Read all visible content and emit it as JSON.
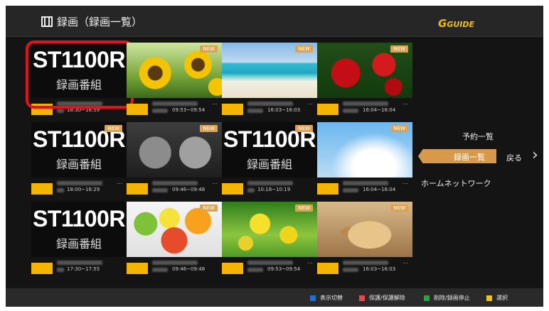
{
  "header": {
    "title": "録画（録画一覧）",
    "logo_text": "GUIDE"
  },
  "new_label": "NEW",
  "st_main": "ST1100R",
  "st_sub": "録画番組",
  "tiles": [
    {
      "kind": "st",
      "time": "18:30~18:59",
      "selected": true
    },
    {
      "kind": "sun",
      "time": "09:53~09:54",
      "new": true,
      "dots": "…"
    },
    {
      "kind": "beach",
      "time": "16:03~16:03",
      "new": true,
      "dots": "…"
    },
    {
      "kind": "roses",
      "time": "16:04~16:04",
      "new": true,
      "dots": "…"
    },
    {
      "kind": "st",
      "time": "18:00~18:29",
      "new": true,
      "dots": "…"
    },
    {
      "kind": "kittens",
      "time": "09:46~09:48",
      "new": true,
      "dots": "…"
    },
    {
      "kind": "st",
      "time": "10:18~10:19",
      "new": true
    },
    {
      "kind": "sky",
      "time": "16:04~16:04",
      "new": true,
      "dots": "…"
    },
    {
      "kind": "st",
      "time": "17:30~17:55"
    },
    {
      "kind": "fruits",
      "time": "09:46~09:48",
      "new": true
    },
    {
      "kind": "rapeseed",
      "time": "09:53~09:54",
      "new": true,
      "dots": "…"
    },
    {
      "kind": "puppy",
      "time": "16:03~16:03",
      "new": true,
      "dots": "…"
    }
  ],
  "side_menu": {
    "reservation": "予約一覧",
    "recorded": "録画一覧",
    "back": "戻る",
    "home_network": "ホームネットワーク"
  },
  "legend": [
    {
      "color": "#1f6fd6",
      "label": "表示切替"
    },
    {
      "color": "#e5484d",
      "label": "保護/保護解除"
    },
    {
      "color": "#2ea043",
      "label": "削除/録画停止"
    },
    {
      "color": "#f1c40f",
      "label": "選択"
    }
  ]
}
